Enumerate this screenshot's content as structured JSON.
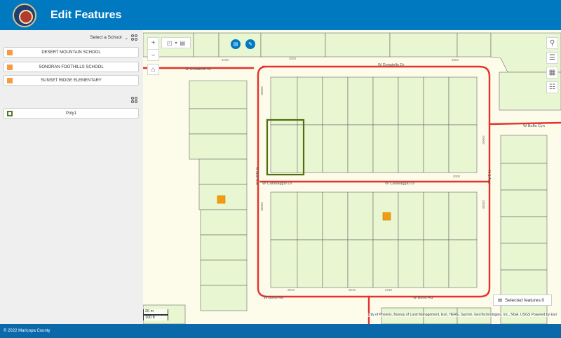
{
  "header": {
    "title": "Edit Features",
    "logo_icon": "maricopa-county-seal"
  },
  "sidebar": {
    "school_select_label": "Select a School",
    "schools": [
      {
        "label": "DESERT MOUNTAIN SCHOOL",
        "color": "#f39c44"
      },
      {
        "label": "SONORAN FOOTHILLS SCHOOL",
        "color": "#f39c44"
      },
      {
        "label": "SUNSET RIDGE ELEMENTARY",
        "color": "#f39c44"
      }
    ],
    "polygons": [
      {
        "label": "Poly1",
        "color": "#4f7a27"
      }
    ]
  },
  "map": {
    "street_labels": {
      "donatello_west": "W Donatello Dr",
      "donatello_east": "W Donatello Dr",
      "caravaggio_west": "W Caravaggio Ln",
      "caravaggio_east": "W Caravaggio Ln",
      "bono_west": "W Bono Rd",
      "bono_east": "W Bono Rd",
      "buffa": "W Buffa Cyn",
      "ave_west": "N 11st Ave",
      "ave_east": "N 1 Ave"
    },
    "address_labels": [
      "3100",
      "3000",
      "3000",
      "3000",
      "2010",
      "2010",
      "2010",
      "20000",
      "20000",
      "20000",
      "20000"
    ],
    "selected_features": "Selected features:0",
    "scale": {
      "metric": "20 m",
      "imperial": "100 ft"
    },
    "attribution": "City of Phoenix, Bureau of Land Management, Esri, HERE, Garmin, GeoTechnologies, Inc., NGA, USGS   Powered by Esri",
    "colors": {
      "parcel_fill": "#e8f7d1",
      "road": "#e5322c",
      "selection": "#4f6e0c",
      "school_marker": "#f39c11"
    }
  },
  "footer": {
    "copyright": "© 2022 Maricopa County"
  }
}
